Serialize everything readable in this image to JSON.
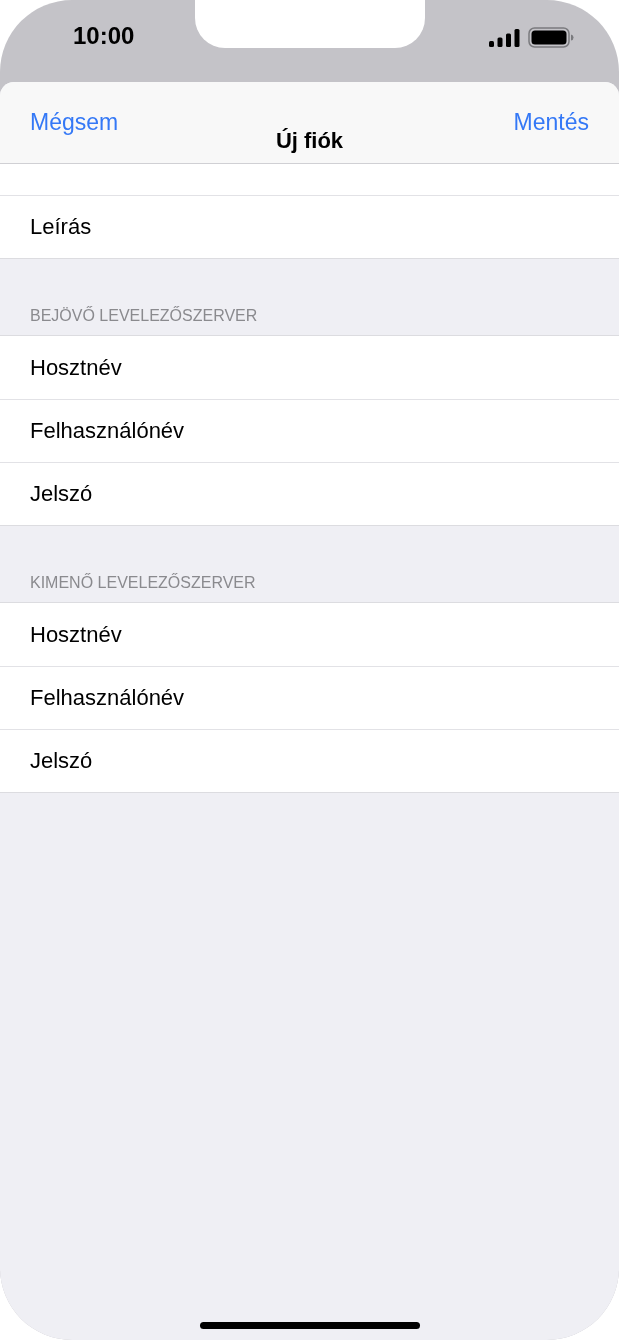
{
  "status_bar": {
    "time": "10:00"
  },
  "nav": {
    "cancel": "Mégsem",
    "title": "Új fiók",
    "save": "Mentés"
  },
  "sections": [
    {
      "rows": [
        {
          "label": "Leírás"
        }
      ]
    },
    {
      "header": "BEJÖVŐ LEVELEZŐSZERVER",
      "rows": [
        {
          "label": "Hosztnév"
        },
        {
          "label": "Felhasználónév"
        },
        {
          "label": "Jelszó"
        }
      ]
    },
    {
      "header": "KIMENŐ LEVELEZŐSZERVER",
      "rows": [
        {
          "label": "Hosztnév"
        },
        {
          "label": "Felhasználónév"
        },
        {
          "label": "Jelszó"
        }
      ]
    }
  ]
}
